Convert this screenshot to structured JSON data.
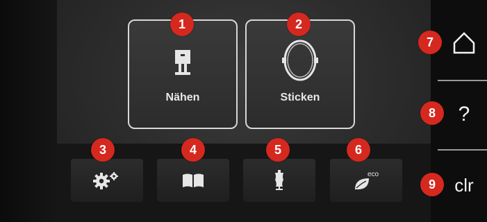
{
  "mode_tiles": {
    "sew_label": "Nähen",
    "embroider_label": "Sticken"
  },
  "bottom_buttons": [
    {
      "icon": "gear-icon"
    },
    {
      "icon": "book-icon"
    },
    {
      "icon": "dress-form-icon"
    },
    {
      "icon": "eco-leaf-icon",
      "badge": "eco"
    }
  ],
  "side_panel": {
    "home_icon": "home-icon",
    "help_label": "?",
    "clear_label": "clr"
  },
  "callouts": [
    "1",
    "2",
    "3",
    "4",
    "5",
    "6",
    "7",
    "8",
    "9"
  ],
  "colors": {
    "callout_red": "#d5281f",
    "tile_border": "#d8d8d8",
    "background": "#101010"
  }
}
